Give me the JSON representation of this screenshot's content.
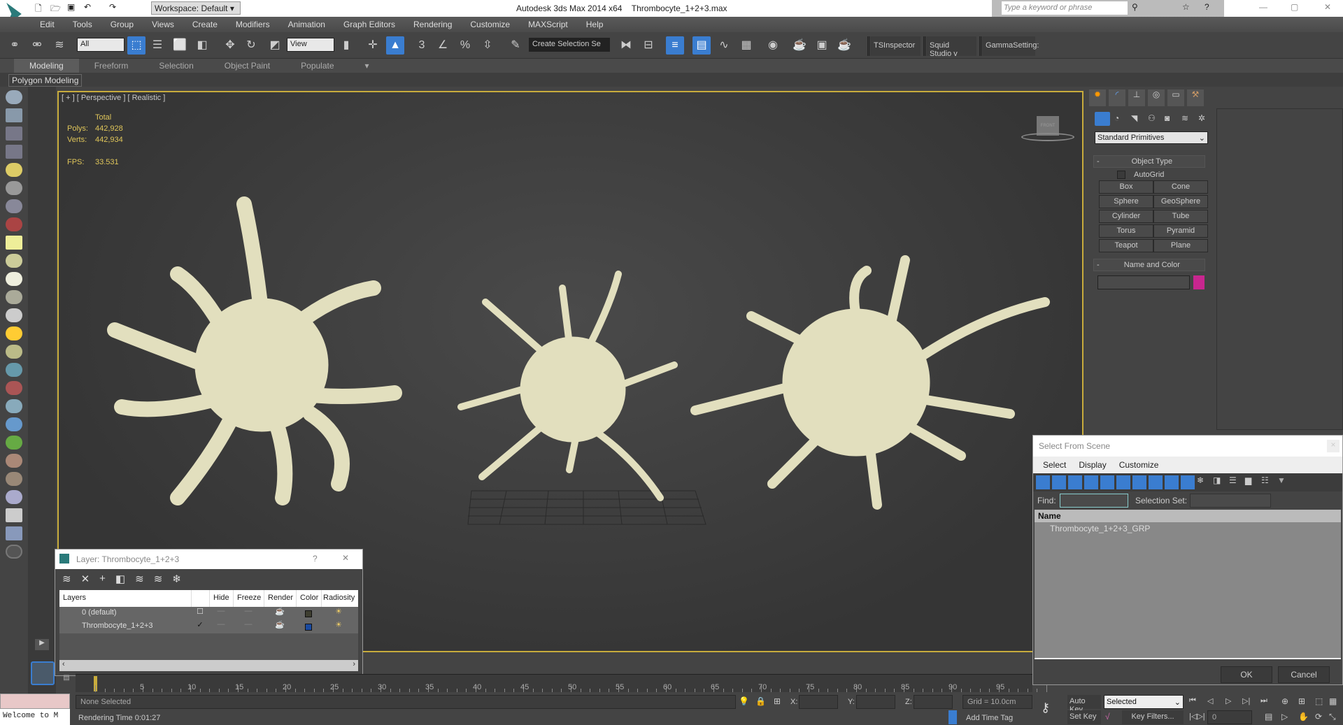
{
  "title": {
    "app": "Autodesk 3ds Max  2014 x64",
    "file": "Thrombocyte_1+2+3.max",
    "workspace": "Workspace: Default",
    "search_placeholder": "Type a keyword or phrase"
  },
  "menu": [
    "Edit",
    "Tools",
    "Group",
    "Views",
    "Create",
    "Modifiers",
    "Animation",
    "Graph Editors",
    "Rendering",
    "Customize",
    "MAXScript",
    "Help"
  ],
  "toolbar": {
    "filter": "All",
    "ref_coord": "View",
    "selection_set": "Create Selection Se",
    "snap_label": "3",
    "plugins": [
      "TSInspector",
      "Squid Studio v",
      "GammaSetting:"
    ]
  },
  "ribbon": {
    "tabs": [
      "Modeling",
      "Freeform",
      "Selection",
      "Object Paint",
      "Populate"
    ],
    "active": "Modeling",
    "panel": "Polygon Modeling"
  },
  "viewport": {
    "label": "[ + ] [ Perspective ] [ Realistic ]",
    "stats": {
      "header": "Total",
      "polys_label": "Polys:",
      "polys": "442,928",
      "verts_label": "Verts:",
      "verts": "442,934",
      "fps_label": "FPS:",
      "fps": "33.531"
    },
    "viewcube": "FRONT"
  },
  "command_panel": {
    "category": "Standard Primitives",
    "object_type": "Object Type",
    "autogrid": "AutoGrid",
    "buttons": [
      "Box",
      "Cone",
      "Sphere",
      "GeoSphere",
      "Cylinder",
      "Tube",
      "Torus",
      "Pyramid",
      "Teapot",
      "Plane"
    ],
    "name_color": "Name and Color",
    "color": "#c8268f"
  },
  "select_from_scene": {
    "title": "Select From Scene",
    "menu": [
      "Select",
      "Display",
      "Customize"
    ],
    "find_label": "Find:",
    "selection_set_label": "Selection Set:",
    "column": "Name",
    "items": [
      "Thrombocyte_1+2+3_GRP"
    ],
    "ok": "OK",
    "cancel": "Cancel"
  },
  "layer_dialog": {
    "title": "Layer: Thrombocyte_1+2+3",
    "help": "?",
    "columns": [
      "Layers",
      "",
      "Hide",
      "Freeze",
      "Render",
      "Color",
      "Radiosity"
    ],
    "rows": [
      {
        "name": "0 (default)",
        "color": "#3e3e30"
      },
      {
        "name": "Thrombocyte_1+2+3",
        "color": "#1a4aa0"
      }
    ]
  },
  "timeline": {
    "labels": [
      "5",
      "10",
      "15",
      "20",
      "25",
      "30",
      "35",
      "40",
      "45",
      "50",
      "55",
      "60",
      "65",
      "70",
      "75",
      "80",
      "85",
      "90",
      "95"
    ],
    "current_frame": "0"
  },
  "status": {
    "script_listener": "Welcome to M",
    "selection": "None Selected",
    "render_time": "Rendering Time  0:01:27",
    "x_label": "X:",
    "y_label": "Y:",
    "z_label": "Z:",
    "grid": "Grid = 10.0cm",
    "add_time_tag": "Add Time Tag",
    "auto_key": "Auto Key",
    "set_key": "Set Key",
    "key_mode": "Selected",
    "key_filters": "Key Filters...",
    "frame": "0"
  }
}
